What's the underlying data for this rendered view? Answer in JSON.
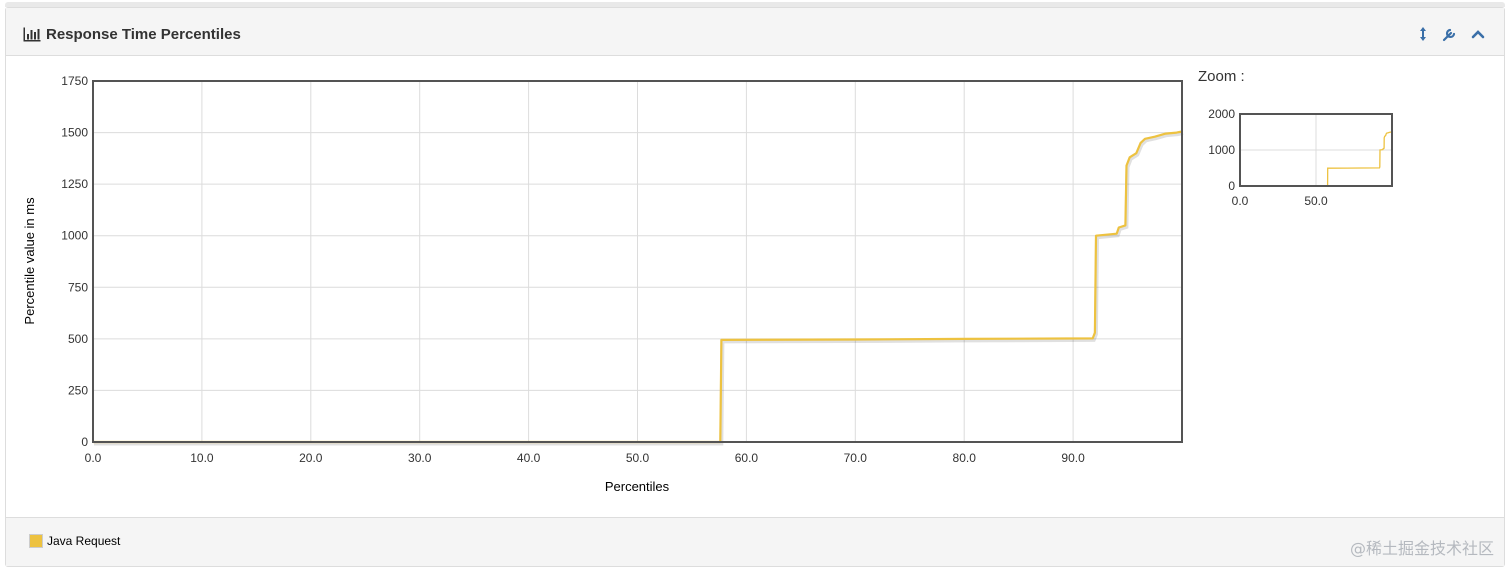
{
  "panel": {
    "title": "Response Time Percentiles",
    "title_icon": "bar-chart-icon",
    "actions": [
      {
        "name": "resize-icon",
        "label": "↕"
      },
      {
        "name": "wrench-icon",
        "label": "🔧"
      },
      {
        "name": "collapse-icon",
        "label": "^"
      }
    ]
  },
  "zoom": {
    "label": "Zoom :",
    "x_ticks": [
      "0.0",
      "50.0"
    ],
    "y_ticks": [
      "0",
      "1000",
      "2000"
    ]
  },
  "legend": {
    "items": [
      {
        "label": "Java Request",
        "color": "#edc240"
      }
    ]
  },
  "watermark": "@稀土掘金技术社区",
  "chart_data": {
    "type": "line",
    "title": "",
    "xlabel": "Percentiles",
    "ylabel": "Percentile value in ms",
    "xlim": [
      0,
      100
    ],
    "ylim": [
      0,
      1750
    ],
    "x_ticks": [
      0,
      10,
      20,
      30,
      40,
      50,
      60,
      70,
      80,
      90
    ],
    "x_tick_labels": [
      "0.0",
      "10.0",
      "20.0",
      "30.0",
      "40.0",
      "50.0",
      "60.0",
      "70.0",
      "80.0",
      "90.0"
    ],
    "y_ticks": [
      0,
      250,
      500,
      750,
      1000,
      1250,
      1500,
      1750
    ],
    "y_tick_labels": [
      "0",
      "250",
      "500",
      "750",
      "1000",
      "1250",
      "1500",
      "1750"
    ],
    "grid": true,
    "legend_position": "bottom-left",
    "series": [
      {
        "name": "Java Request",
        "color": "#edc240",
        "points": [
          [
            0,
            0
          ],
          [
            57.6,
            0
          ],
          [
            57.7,
            495
          ],
          [
            70,
            497
          ],
          [
            80,
            500
          ],
          [
            91.8,
            502
          ],
          [
            92.0,
            530
          ],
          [
            92.1,
            1000
          ],
          [
            94.0,
            1010
          ],
          [
            94.2,
            1040
          ],
          [
            94.8,
            1050
          ],
          [
            94.9,
            1340
          ],
          [
            95.2,
            1380
          ],
          [
            95.8,
            1400
          ],
          [
            96.2,
            1450
          ],
          [
            96.6,
            1470
          ],
          [
            97.5,
            1480
          ],
          [
            98.5,
            1495
          ],
          [
            99.5,
            1500
          ],
          [
            100,
            1505
          ]
        ]
      }
    ]
  }
}
